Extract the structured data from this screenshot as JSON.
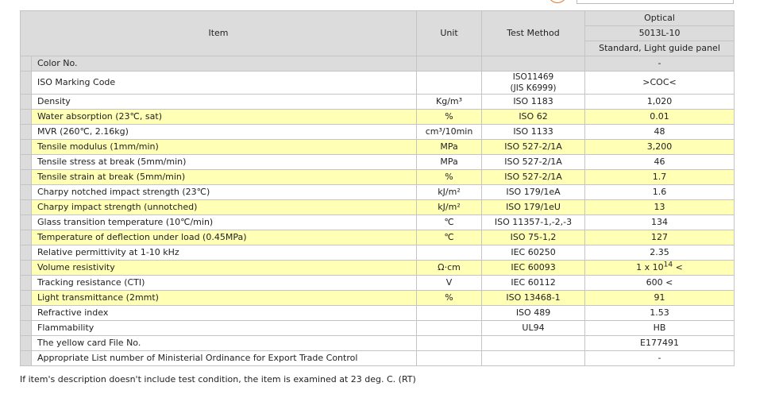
{
  "header": {
    "item": "Item",
    "unit": "Unit",
    "test_method": "Test Method",
    "grade_category": "Optical",
    "grade_name": "5013L-10",
    "grade_desc": "Standard, Light guide panel"
  },
  "rows": [
    {
      "item": "Color No.",
      "unit": "",
      "method": "",
      "value": "-",
      "style": "grey"
    },
    {
      "item": "ISO Marking Code",
      "unit": "",
      "method_line1": "ISO11469",
      "method_line2": "(JIS K6999)",
      "value": ">COC<",
      "style": "white"
    },
    {
      "item": "Density",
      "unit": "Kg/m³",
      "method": "ISO 1183",
      "value": "1,020",
      "style": "white"
    },
    {
      "item": "Water absorption (23℃, sat)",
      "unit": "%",
      "method": "ISO 62",
      "value": "0.01",
      "style": "yellow"
    },
    {
      "item": "MVR (260℃, 2.16kg)",
      "unit": "cm³/10min",
      "method": "ISO 1133",
      "value": "48",
      "style": "white"
    },
    {
      "item": "Tensile modulus (1mm/min)",
      "unit": "MPa",
      "method": "ISO 527-2/1A",
      "value": "3,200",
      "style": "yellow"
    },
    {
      "item": "Tensile stress at break (5mm/min)",
      "unit": "MPa",
      "method": "ISO 527-2/1A",
      "value": "46",
      "style": "white"
    },
    {
      "item": "Tensile strain at break (5mm/min)",
      "unit": "%",
      "method": "ISO 527-2/1A",
      "value": "1.7",
      "style": "yellow"
    },
    {
      "item": "Charpy notched impact strength (23℃)",
      "unit": "kJ/m²",
      "method": "ISO 179/1eA",
      "value": "1.6",
      "style": "white"
    },
    {
      "item": "Charpy impact strength (unnotched)",
      "unit": "kJ/m²",
      "method": "ISO 179/1eU",
      "value": "13",
      "style": "yellow"
    },
    {
      "item": "Glass transition temperature (10℃/min)",
      "unit": "℃",
      "method": "ISO 11357-1,-2,-3",
      "value": "134",
      "style": "white"
    },
    {
      "item": "Temperature of deflection under load (0.45MPa)",
      "unit": "℃",
      "method": "ISO 75-1,2",
      "value": "127",
      "style": "yellow"
    },
    {
      "item": "Relative permittivity at 1-10 kHz",
      "unit": "",
      "method": "IEC 60250",
      "value": "2.35",
      "style": "white"
    },
    {
      "item": "Volume resistivity",
      "unit": "Ω·cm",
      "method": "IEC 60093",
      "value_base": "1 x 10",
      "value_exp": "14",
      "value_suffix": " <",
      "style": "yellow"
    },
    {
      "item": "Tracking resistance (CTI)",
      "unit": "V",
      "method": "IEC 60112",
      "value": "600 <",
      "style": "white"
    },
    {
      "item": "Light transmittance (2mmt)",
      "unit": "%",
      "method": "ISO 13468-1",
      "value": "91",
      "style": "yellow"
    },
    {
      "item": "Refractive index",
      "unit": "",
      "method": "ISO 489",
      "value": "1.53",
      "style": "white"
    },
    {
      "item": "Flammability",
      "unit": "",
      "method": "UL94",
      "value": "HB",
      "style": "white"
    },
    {
      "item": "The yellow card File No.",
      "unit": "",
      "method": "",
      "value": "E177491",
      "style": "white"
    },
    {
      "item": "Appropriate List number of Ministerial Ordinance for Export Trade Control",
      "unit": "",
      "method": "",
      "value": "-",
      "style": "white"
    }
  ],
  "footnote": "If item's description doesn't include test condition, the item is examined at 23 deg. C. (RT)",
  "colors": {
    "header_bg": "#dcdcdc",
    "highlight_row": "#ffffb5",
    "border": "#c4c4c4"
  }
}
